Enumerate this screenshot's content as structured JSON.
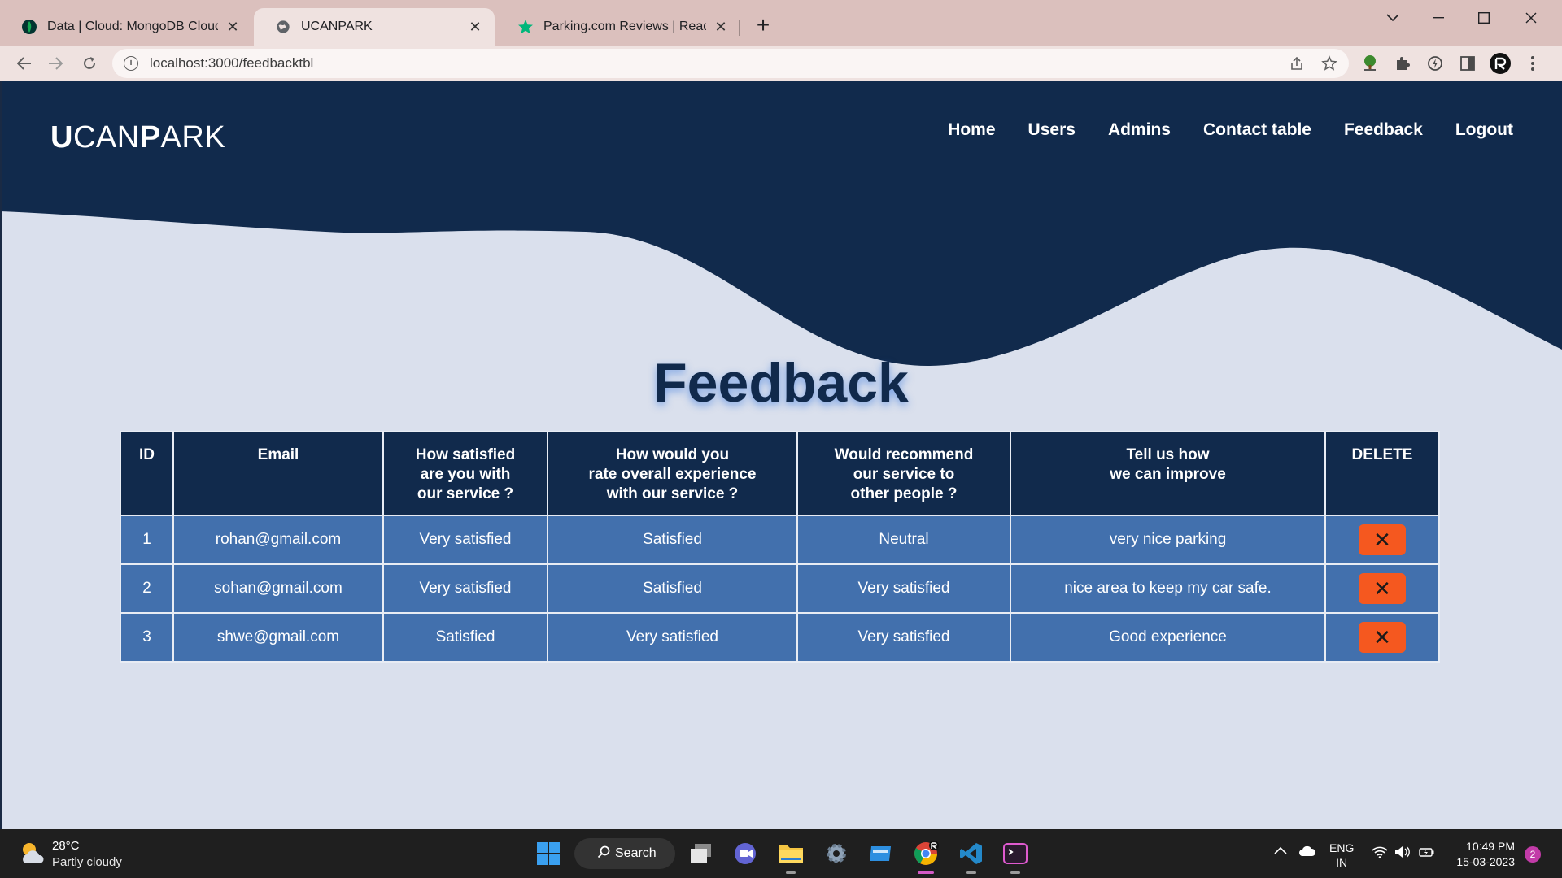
{
  "browser": {
    "tabs": [
      {
        "title": "Data | Cloud: MongoDB Cloud",
        "icon": "mongodb-leaf-icon",
        "active": false
      },
      {
        "title": "UCANPARK",
        "icon": "globe-icon",
        "active": true
      },
      {
        "title": "Parking.com Reviews | Read Custo",
        "icon": "star-icon",
        "active": false
      }
    ],
    "url": "localhost:3000/feedbacktbl"
  },
  "site": {
    "brand_pre": "U",
    "brand_mid": "CAN",
    "brand_bold": "P",
    "brand_post": "ARK",
    "nav": [
      "Home",
      "Users",
      "Admins",
      "Contact table",
      "Feedback",
      "Logout"
    ],
    "colors": {
      "header_bg": "#112a4c",
      "page_bg": "#dae0ed",
      "row_bg": "#4270ad",
      "delete_bg": "#f5581f"
    }
  },
  "feedback": {
    "heading": "Feedback",
    "headers": [
      [
        "ID"
      ],
      [
        "Email"
      ],
      [
        "How satisfied",
        "are you with",
        "our service ?"
      ],
      [
        "How would you",
        "rate overall experience",
        "with our service ?"
      ],
      [
        "Would recommend",
        "our service to",
        "other people ?"
      ],
      [
        "Tell us how",
        "we can improve"
      ],
      [
        "DELETE"
      ]
    ],
    "rows": [
      {
        "id": "1",
        "email": "rohan@gmail.com",
        "satisfied": "Very satisfied",
        "overall": "Satisfied",
        "recommend": "Neutral",
        "improve": "very nice parking"
      },
      {
        "id": "2",
        "email": "sohan@gmail.com",
        "satisfied": "Very satisfied",
        "overall": "Satisfied",
        "recommend": "Very satisfied",
        "improve": "nice area to keep my car safe."
      },
      {
        "id": "3",
        "email": "shwe@gmail.com",
        "satisfied": "Satisfied",
        "overall": "Very satisfied",
        "recommend": "Very satisfied",
        "improve": "Good experience"
      }
    ],
    "delete_symbol": "✕"
  },
  "taskbar": {
    "weather_temp": "28°C",
    "weather_desc": "Partly cloudy",
    "search_label": "Search",
    "lang_line1": "ENG",
    "lang_line2": "IN",
    "time": "10:49 PM",
    "date": "15-03-2023",
    "notifications": "2"
  }
}
